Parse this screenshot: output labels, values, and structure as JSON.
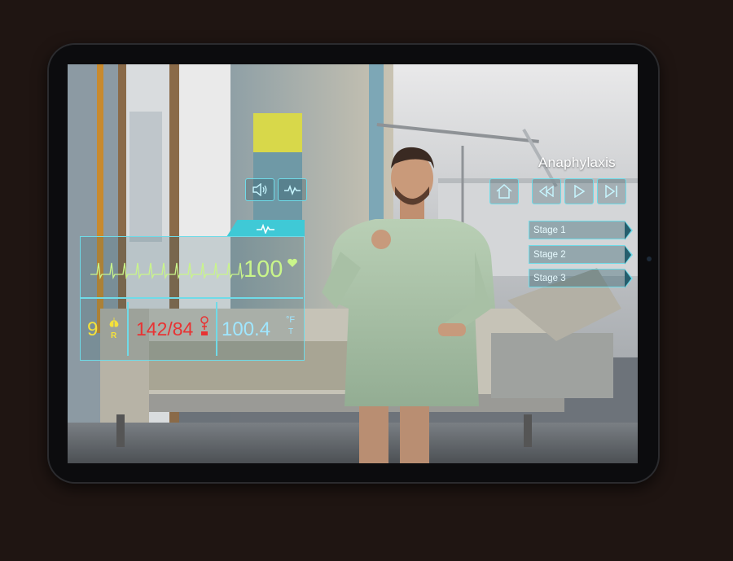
{
  "scenario": {
    "title": "Anaphylaxis",
    "stages": [
      "Stage 1",
      "Stage 2",
      "Stage 3"
    ]
  },
  "controls": {
    "icons": [
      "speaker-icon",
      "heartbeat-icon",
      "home-icon",
      "rewind-icon",
      "play-icon",
      "skip-icon"
    ]
  },
  "vitals": {
    "heart_rate": "100",
    "resp_rate": "9",
    "resp_unit": "R",
    "blood_pressure": "142/84",
    "temperature": "100.4",
    "temp_unit_top": "°F",
    "temp_unit_bottom": "T"
  },
  "colors": {
    "hud_cyan": "#6fdbe8",
    "ecg_green": "#c9f58a",
    "resp_yellow": "#f5e23a",
    "bp_red": "#e83333",
    "temp_blue": "#9fe6ff"
  }
}
